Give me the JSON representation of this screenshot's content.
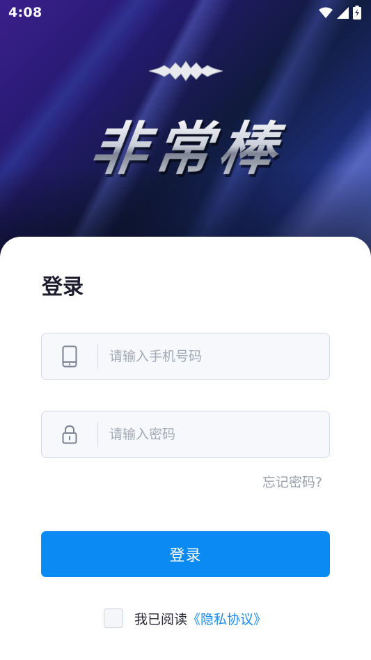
{
  "status_bar": {
    "time": "4:08",
    "icons": [
      "wifi-icon",
      "signal-icon",
      "battery-charging-icon"
    ]
  },
  "hero": {
    "title": "非常棒",
    "emblem": "logo-emblem"
  },
  "login": {
    "title": "登录",
    "phone_placeholder": "请输入手机号码",
    "password_placeholder": "请输入密码",
    "phone_icon": "phone-icon",
    "lock_icon": "lock-icon",
    "forgot_password": "忘记密码?",
    "submit_label": "登录",
    "agreement_prefix": "我已阅读",
    "agreement_link": "《隐私协议》"
  },
  "colors": {
    "primary": "#0a8af2",
    "link": "#1a8cf0",
    "title": "#1c1c2e",
    "placeholder": "#a3a9b5",
    "field_bg": "#f6f8fb"
  }
}
